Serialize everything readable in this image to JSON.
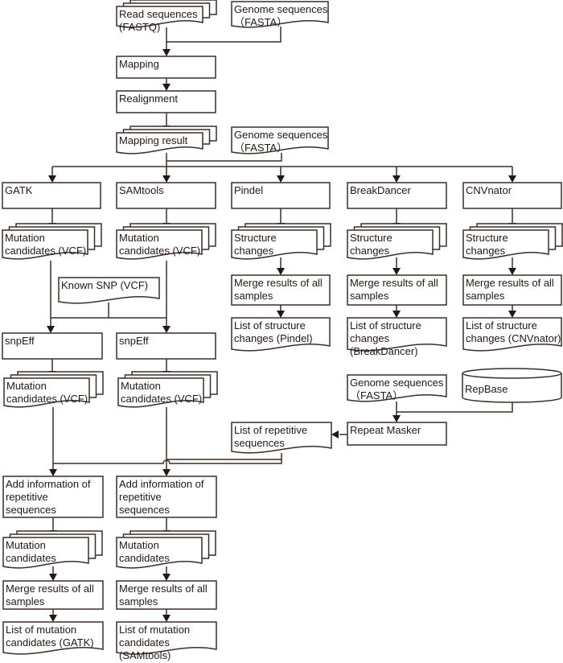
{
  "colors": {
    "line": "#3a2e28",
    "text": "#231815",
    "background": "#ffffff"
  },
  "nodes": [
    {
      "id": "read-seq",
      "shape": "multi-document",
      "lines": [
        "Read sequences",
        "(FASTQ)"
      ]
    },
    {
      "id": "genome-1",
      "shape": "document",
      "lines": [
        "Genome sequences",
        "（FASTA）"
      ]
    },
    {
      "id": "mapping",
      "shape": "process",
      "lines": [
        "Mapping"
      ]
    },
    {
      "id": "realignment",
      "shape": "process",
      "lines": [
        "Realignment"
      ]
    },
    {
      "id": "mapping-result",
      "shape": "multi-document",
      "lines": [
        "Mapping result"
      ]
    },
    {
      "id": "genome-2",
      "shape": "document",
      "lines": [
        "Genome sequences",
        "（FASTA）"
      ]
    },
    {
      "id": "gatk",
      "shape": "process",
      "lines": [
        "GATK"
      ]
    },
    {
      "id": "samtools",
      "shape": "process",
      "lines": [
        "SAMtools"
      ]
    },
    {
      "id": "pindel",
      "shape": "process",
      "lines": [
        "Pindel"
      ]
    },
    {
      "id": "breakdancer",
      "shape": "process",
      "lines": [
        "BreakDancer"
      ]
    },
    {
      "id": "cnvnator",
      "shape": "process",
      "lines": [
        "CNVnator"
      ]
    },
    {
      "id": "mut-vcf-gatk",
      "shape": "multi-document",
      "lines": [
        "Mutation",
        "candidates (VCF)"
      ]
    },
    {
      "id": "mut-vcf-sam",
      "shape": "multi-document",
      "lines": [
        "Mutation",
        "candidates (VCF)"
      ]
    },
    {
      "id": "struct-pindel",
      "shape": "multi-document",
      "lines": [
        "Structure",
        "changes"
      ]
    },
    {
      "id": "struct-bd",
      "shape": "multi-document",
      "lines": [
        "Structure",
        "changes"
      ]
    },
    {
      "id": "struct-cnv",
      "shape": "multi-document",
      "lines": [
        "Structure",
        "changes"
      ]
    },
    {
      "id": "merge-pindel",
      "shape": "process",
      "lines": [
        "Merge results of all",
        "samples"
      ]
    },
    {
      "id": "merge-bd",
      "shape": "process",
      "lines": [
        "Merge results of all",
        "samples"
      ]
    },
    {
      "id": "merge-cnv",
      "shape": "process",
      "lines": [
        "Merge results of all",
        "samples"
      ]
    },
    {
      "id": "list-pindel",
      "shape": "document",
      "lines": [
        "List of structure",
        "changes (Pindel)"
      ]
    },
    {
      "id": "list-bd",
      "shape": "document",
      "lines": [
        "List of structure",
        "changes",
        "(BreakDancer)"
      ]
    },
    {
      "id": "list-cnv",
      "shape": "document",
      "lines": [
        "List of structure",
        "changes (CNVnator)"
      ]
    },
    {
      "id": "known-snp",
      "shape": "document",
      "lines": [
        "Known SNP (VCF)"
      ]
    },
    {
      "id": "snpeff-gatk",
      "shape": "process",
      "lines": [
        "snpEff"
      ]
    },
    {
      "id": "snpeff-sam",
      "shape": "process",
      "lines": [
        "snpEff"
      ]
    },
    {
      "id": "mut-vcf2-gatk",
      "shape": "multi-document",
      "lines": [
        "Mutation",
        "candidates (VCF)"
      ]
    },
    {
      "id": "mut-vcf2-sam",
      "shape": "multi-document",
      "lines": [
        "Mutation",
        "candidates (VCF)"
      ]
    },
    {
      "id": "genome-3",
      "shape": "document",
      "lines": [
        "Genome sequences",
        "（FASTA）"
      ]
    },
    {
      "id": "repbase",
      "shape": "database",
      "lines": [
        "RepBase"
      ]
    },
    {
      "id": "repeat-masker",
      "shape": "process",
      "lines": [
        "Repeat Masker"
      ]
    },
    {
      "id": "list-repetitive",
      "shape": "document",
      "lines": [
        "List of repetitive",
        "sequences"
      ]
    },
    {
      "id": "addinfo-gatk",
      "shape": "process",
      "lines": [
        "Add information of",
        "repetitive",
        "sequences"
      ]
    },
    {
      "id": "addinfo-sam",
      "shape": "process",
      "lines": [
        "Add information of",
        "repetitive",
        "sequences"
      ]
    },
    {
      "id": "mut-gatk",
      "shape": "multi-document",
      "lines": [
        "Mutation",
        "candidates"
      ]
    },
    {
      "id": "mut-sam",
      "shape": "multi-document",
      "lines": [
        "Mutation",
        "candidates"
      ]
    },
    {
      "id": "merge-gatk",
      "shape": "process",
      "lines": [
        "Merge results of all",
        "samples"
      ]
    },
    {
      "id": "merge-sam",
      "shape": "process",
      "lines": [
        "Merge results of all",
        "samples"
      ]
    },
    {
      "id": "list-gatk",
      "shape": "document",
      "lines": [
        "List of mutation",
        "candidates (GATK)"
      ]
    },
    {
      "id": "list-sam",
      "shape": "document",
      "lines": [
        "List of mutation",
        "candidates",
        "(SAMtools)"
      ]
    }
  ]
}
